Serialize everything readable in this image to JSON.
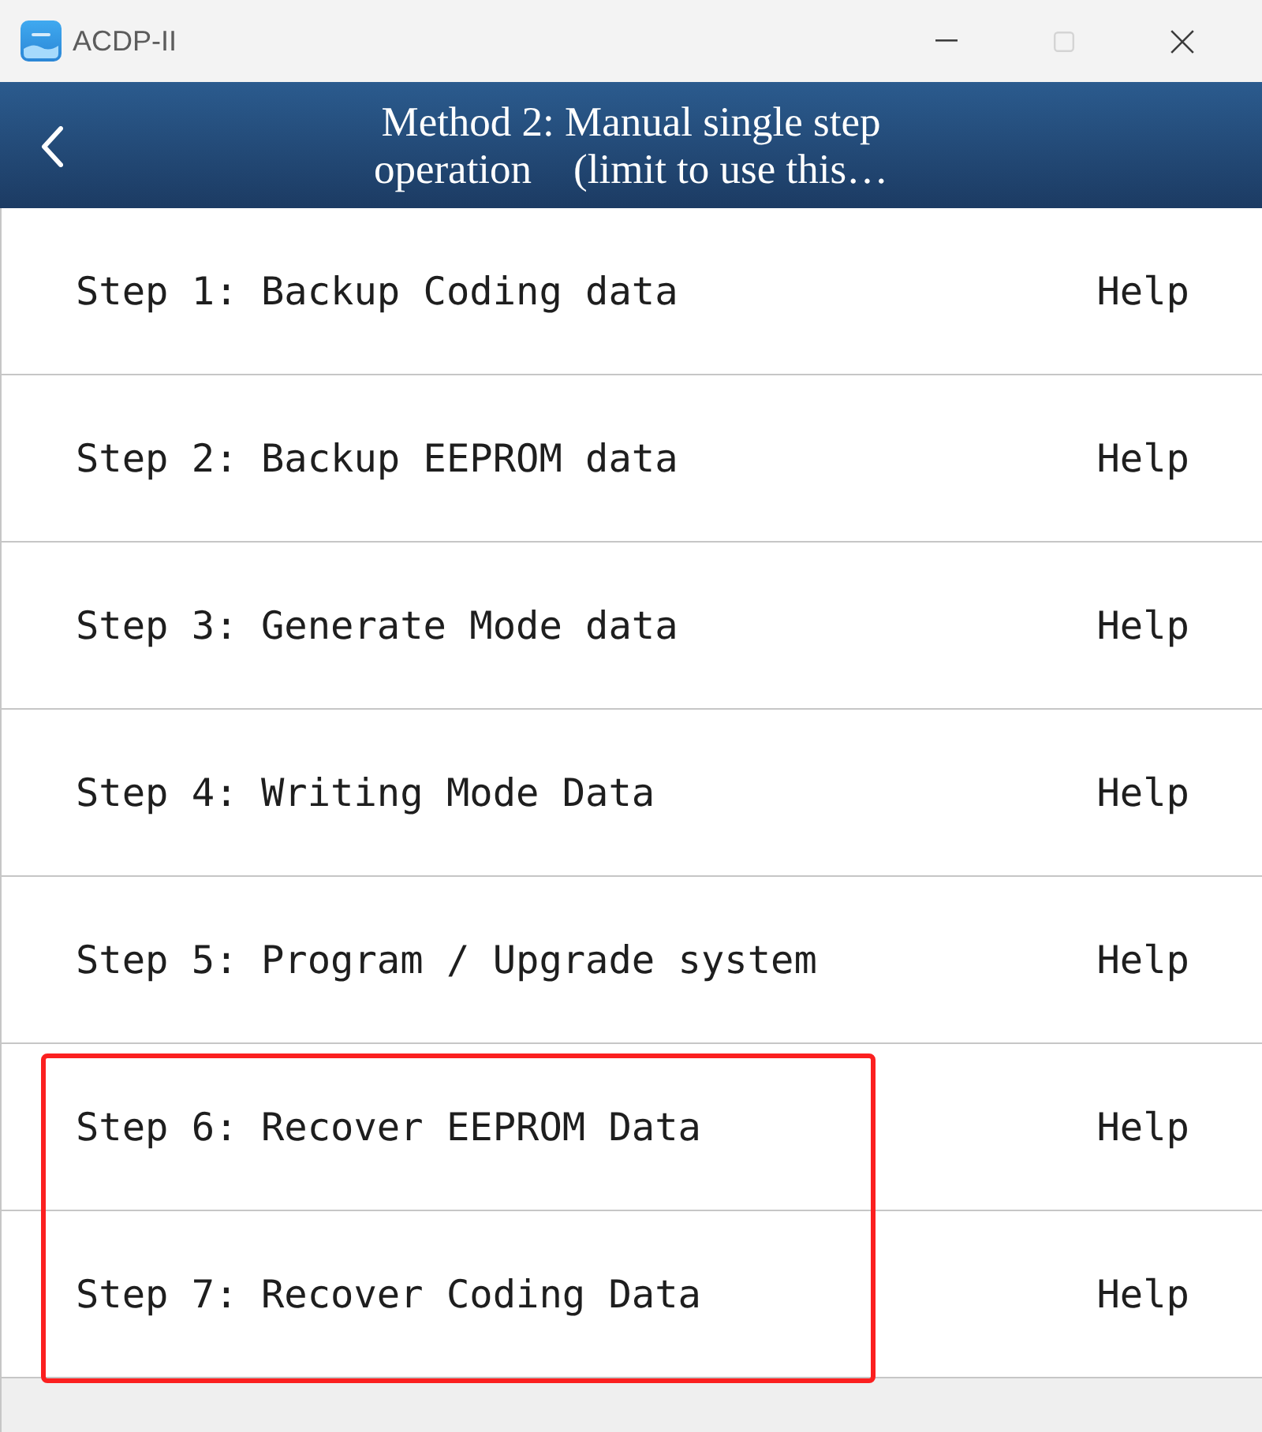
{
  "window": {
    "title": "ACDP-II",
    "controls": [
      {
        "kind": "minimize",
        "disabled": false
      },
      {
        "kind": "maximize",
        "disabled": true
      },
      {
        "kind": "close",
        "disabled": false
      }
    ]
  },
  "header": {
    "title": "Method 2: Manual single step\noperation    (limit to use this…"
  },
  "steps": [
    {
      "label": "Step 1: Backup Coding data",
      "help": "Help",
      "highlighted": false
    },
    {
      "label": "Step 2: Backup EEPROM data",
      "help": "Help",
      "highlighted": false
    },
    {
      "label": "Step 3: Generate Mode data",
      "help": "Help",
      "highlighted": false
    },
    {
      "label": "Step 4: Writing Mode Data",
      "help": "Help",
      "highlighted": false
    },
    {
      "label": "Step 5: Program / Upgrade system",
      "help": "Help",
      "highlighted": false
    },
    {
      "label": "Step 6: Recover EEPROM Data",
      "help": "Help",
      "highlighted": true
    },
    {
      "label": "Step 7: Recover Coding Data",
      "help": "Help",
      "highlighted": true
    }
  ]
}
